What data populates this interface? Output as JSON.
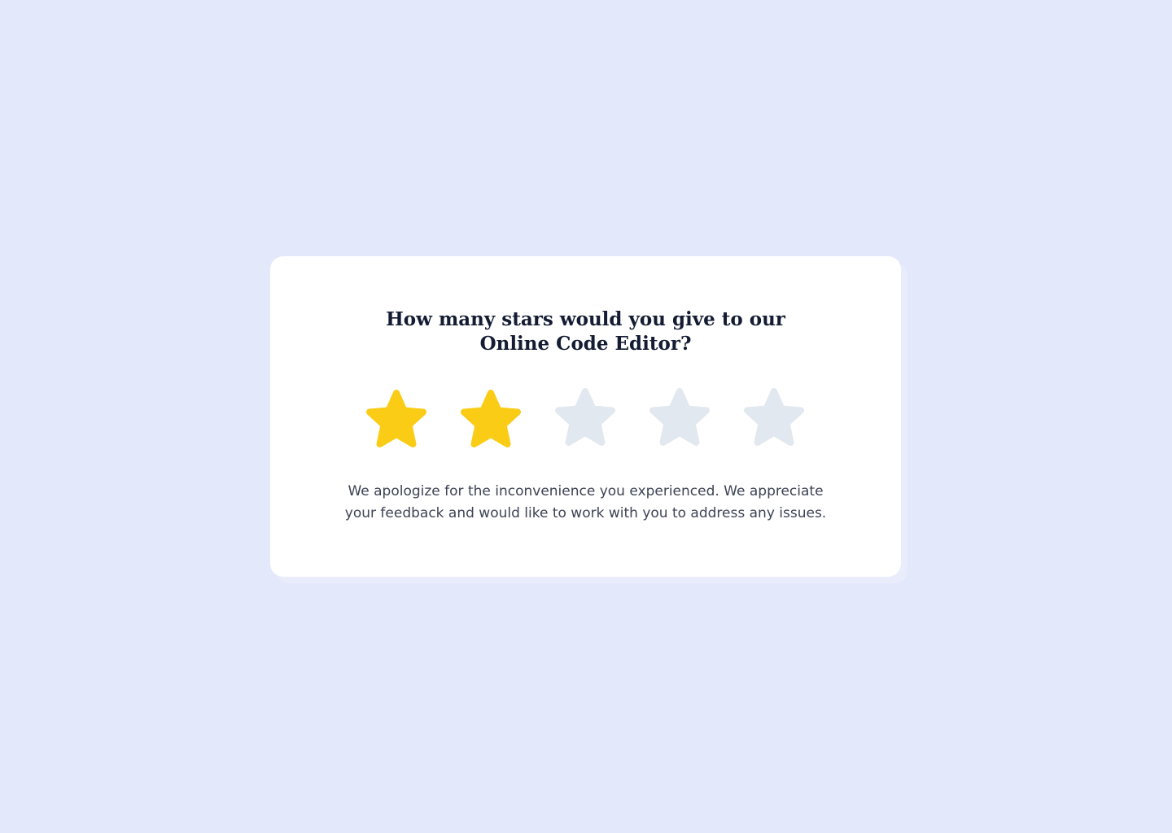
{
  "rating": {
    "question_line1": "How many stars would you give to our",
    "question_line2": "Online Code Editor?",
    "max_stars": 5,
    "selected": 2,
    "filled_color": "#facc15",
    "empty_color": "#e2e8f0",
    "message_line1": "We apologize for the inconvenience you experienced. We appreciate",
    "message_line2": "your feedback and would like to work with you to address any issues."
  }
}
